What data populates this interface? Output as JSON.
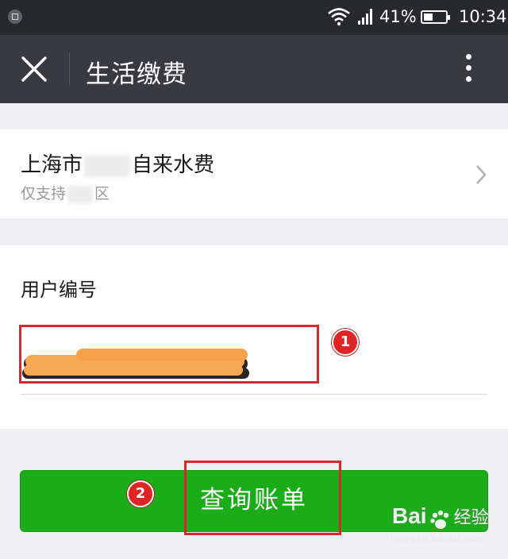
{
  "status_bar": {
    "battery_percent": "41%",
    "battery_level": 0.41,
    "time": "10:34",
    "icons": [
      "app-notification-icon",
      "wifi-icon",
      "signal-icon",
      "battery-icon"
    ]
  },
  "nav": {
    "title": "生活缴费",
    "close_icon": "close-icon",
    "more_icon": "more-vertical-icon"
  },
  "service": {
    "title_prefix": "上海市",
    "title_suffix": "自来水费",
    "subtitle_prefix": "仅支持",
    "subtitle_suffix": "区",
    "chevron_icon": "chevron-right-icon"
  },
  "form": {
    "account_label": "用户编号",
    "account_value_redacted": true
  },
  "query_button": {
    "label": "查询账单"
  },
  "annotations": {
    "marker_1": "1",
    "marker_2": "2",
    "highlight_color": "#d62a2a"
  },
  "watermark": {
    "logo": "Bai",
    "logo_suffix": "经验",
    "url": "jingyan.baidu.com"
  },
  "colors": {
    "status_bar": "#28292c",
    "nav_bar": "#393a3f",
    "background": "#efeff4",
    "primary_green": "#1aad19"
  }
}
